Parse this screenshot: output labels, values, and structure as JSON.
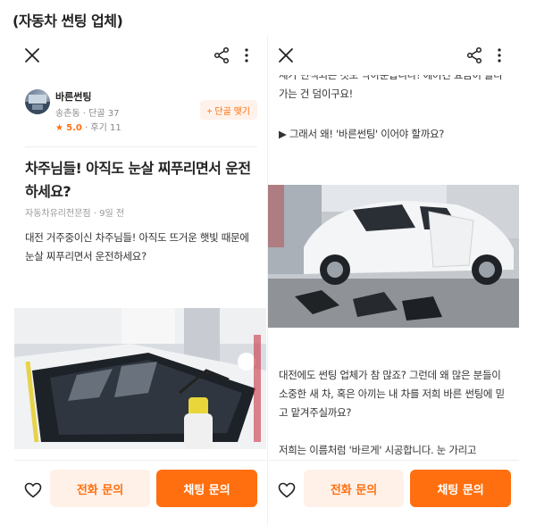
{
  "caption": "(자동차 썬팅 업체)",
  "colors": {
    "accent": "#ff6f0f",
    "accent_soft": "#fff1e8"
  },
  "icons": [
    "close-icon",
    "share-icon",
    "more-vertical-icon",
    "heart-icon",
    "star-icon"
  ],
  "seller": {
    "name": "바른썬팅",
    "meta": "송촌동 · 단골 37",
    "rating_star": "★",
    "rating_score": "5.0",
    "reviews": " · 후기 11",
    "regular_button": "+ 단골 맺기"
  },
  "post": {
    "title": "차주님들! 아직도 눈살 찌푸리면서 운전하세요?",
    "meta": "자동차유리전문점 · 9일 전",
    "intro": "대전 거주중이신 차주님들! 아직도 뜨거운 햇빛 때문에 눈살 찌푸리면서 운전하세요?"
  },
  "right_panel": {
    "top_text": "세가 면색되는 것도 막아준답니다! 에어컨 요금이 올라가는 건 덤이구요!",
    "question": "▶ 그래서 왜! '바른썬팅' 이어야 할까요?",
    "paragraph1": "대전에도 썬팅 업체가 참 많죠? 그런데 왜 많은 분들이 소중한 새 차, 혹은 아끼는 내 차를 저희 바른 썬팅에 믿고 맡겨주실까요?",
    "paragraph2": "저희는 이름처럼 '바르게' 시공합니다. 눈 가리고"
  },
  "actions": {
    "call": "전화 문의",
    "chat": "채팅 문의"
  }
}
